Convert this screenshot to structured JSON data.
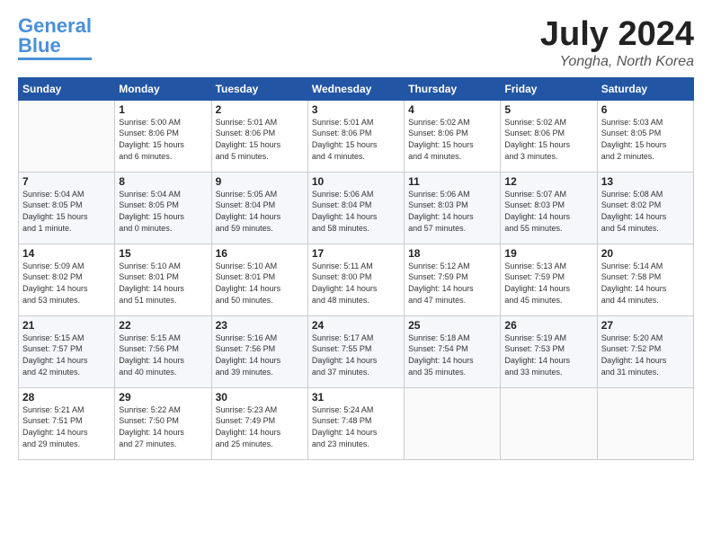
{
  "logo": {
    "text1": "General",
    "text2": "Blue"
  },
  "title": {
    "month": "July 2024",
    "location": "Yongha, North Korea"
  },
  "headers": [
    "Sunday",
    "Monday",
    "Tuesday",
    "Wednesday",
    "Thursday",
    "Friday",
    "Saturday"
  ],
  "weeks": [
    [
      {
        "day": "",
        "info": ""
      },
      {
        "day": "1",
        "info": "Sunrise: 5:00 AM\nSunset: 8:06 PM\nDaylight: 15 hours\nand 6 minutes."
      },
      {
        "day": "2",
        "info": "Sunrise: 5:01 AM\nSunset: 8:06 PM\nDaylight: 15 hours\nand 5 minutes."
      },
      {
        "day": "3",
        "info": "Sunrise: 5:01 AM\nSunset: 8:06 PM\nDaylight: 15 hours\nand 4 minutes."
      },
      {
        "day": "4",
        "info": "Sunrise: 5:02 AM\nSunset: 8:06 PM\nDaylight: 15 hours\nand 4 minutes."
      },
      {
        "day": "5",
        "info": "Sunrise: 5:02 AM\nSunset: 8:06 PM\nDaylight: 15 hours\nand 3 minutes."
      },
      {
        "day": "6",
        "info": "Sunrise: 5:03 AM\nSunset: 8:05 PM\nDaylight: 15 hours\nand 2 minutes."
      }
    ],
    [
      {
        "day": "7",
        "info": "Sunrise: 5:04 AM\nSunset: 8:05 PM\nDaylight: 15 hours\nand 1 minute."
      },
      {
        "day": "8",
        "info": "Sunrise: 5:04 AM\nSunset: 8:05 PM\nDaylight: 15 hours\nand 0 minutes."
      },
      {
        "day": "9",
        "info": "Sunrise: 5:05 AM\nSunset: 8:04 PM\nDaylight: 14 hours\nand 59 minutes."
      },
      {
        "day": "10",
        "info": "Sunrise: 5:06 AM\nSunset: 8:04 PM\nDaylight: 14 hours\nand 58 minutes."
      },
      {
        "day": "11",
        "info": "Sunrise: 5:06 AM\nSunset: 8:03 PM\nDaylight: 14 hours\nand 57 minutes."
      },
      {
        "day": "12",
        "info": "Sunrise: 5:07 AM\nSunset: 8:03 PM\nDaylight: 14 hours\nand 55 minutes."
      },
      {
        "day": "13",
        "info": "Sunrise: 5:08 AM\nSunset: 8:02 PM\nDaylight: 14 hours\nand 54 minutes."
      }
    ],
    [
      {
        "day": "14",
        "info": "Sunrise: 5:09 AM\nSunset: 8:02 PM\nDaylight: 14 hours\nand 53 minutes."
      },
      {
        "day": "15",
        "info": "Sunrise: 5:10 AM\nSunset: 8:01 PM\nDaylight: 14 hours\nand 51 minutes."
      },
      {
        "day": "16",
        "info": "Sunrise: 5:10 AM\nSunset: 8:01 PM\nDaylight: 14 hours\nand 50 minutes."
      },
      {
        "day": "17",
        "info": "Sunrise: 5:11 AM\nSunset: 8:00 PM\nDaylight: 14 hours\nand 48 minutes."
      },
      {
        "day": "18",
        "info": "Sunrise: 5:12 AM\nSunset: 7:59 PM\nDaylight: 14 hours\nand 47 minutes."
      },
      {
        "day": "19",
        "info": "Sunrise: 5:13 AM\nSunset: 7:59 PM\nDaylight: 14 hours\nand 45 minutes."
      },
      {
        "day": "20",
        "info": "Sunrise: 5:14 AM\nSunset: 7:58 PM\nDaylight: 14 hours\nand 44 minutes."
      }
    ],
    [
      {
        "day": "21",
        "info": "Sunrise: 5:15 AM\nSunset: 7:57 PM\nDaylight: 14 hours\nand 42 minutes."
      },
      {
        "day": "22",
        "info": "Sunrise: 5:15 AM\nSunset: 7:56 PM\nDaylight: 14 hours\nand 40 minutes."
      },
      {
        "day": "23",
        "info": "Sunrise: 5:16 AM\nSunset: 7:56 PM\nDaylight: 14 hours\nand 39 minutes."
      },
      {
        "day": "24",
        "info": "Sunrise: 5:17 AM\nSunset: 7:55 PM\nDaylight: 14 hours\nand 37 minutes."
      },
      {
        "day": "25",
        "info": "Sunrise: 5:18 AM\nSunset: 7:54 PM\nDaylight: 14 hours\nand 35 minutes."
      },
      {
        "day": "26",
        "info": "Sunrise: 5:19 AM\nSunset: 7:53 PM\nDaylight: 14 hours\nand 33 minutes."
      },
      {
        "day": "27",
        "info": "Sunrise: 5:20 AM\nSunset: 7:52 PM\nDaylight: 14 hours\nand 31 minutes."
      }
    ],
    [
      {
        "day": "28",
        "info": "Sunrise: 5:21 AM\nSunset: 7:51 PM\nDaylight: 14 hours\nand 29 minutes."
      },
      {
        "day": "29",
        "info": "Sunrise: 5:22 AM\nSunset: 7:50 PM\nDaylight: 14 hours\nand 27 minutes."
      },
      {
        "day": "30",
        "info": "Sunrise: 5:23 AM\nSunset: 7:49 PM\nDaylight: 14 hours\nand 25 minutes."
      },
      {
        "day": "31",
        "info": "Sunrise: 5:24 AM\nSunset: 7:48 PM\nDaylight: 14 hours\nand 23 minutes."
      },
      {
        "day": "",
        "info": ""
      },
      {
        "day": "",
        "info": ""
      },
      {
        "day": "",
        "info": ""
      }
    ]
  ]
}
